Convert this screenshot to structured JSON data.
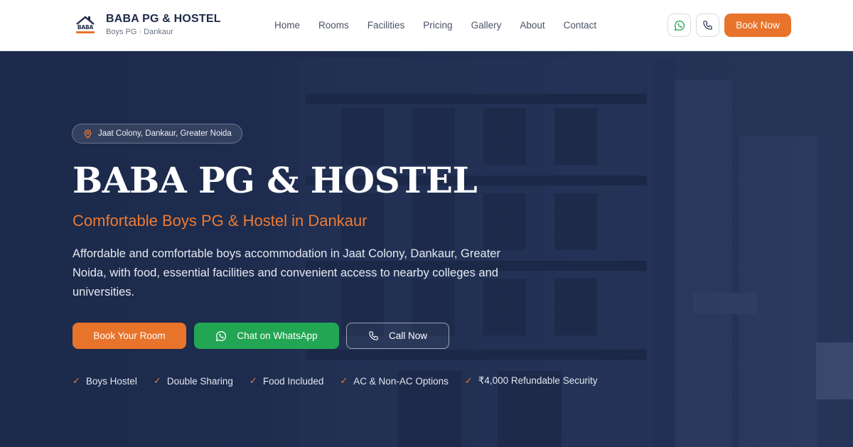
{
  "header": {
    "brand_name": "BABA PG & HOSTEL",
    "brand_sub": "Boys PG · Dankaur",
    "logo_text": "BABA",
    "nav": [
      {
        "label": "Home"
      },
      {
        "label": "Rooms"
      },
      {
        "label": "Facilities"
      },
      {
        "label": "Pricing"
      },
      {
        "label": "Gallery"
      },
      {
        "label": "About"
      },
      {
        "label": "Contact"
      }
    ],
    "whatsapp_icon": "whatsapp-icon",
    "phone_icon": "phone-icon",
    "book_label": "Book Now"
  },
  "hero": {
    "location": "Jaat Colony, Dankaur, Greater Noida",
    "title": "BABA PG & HOSTEL",
    "subtitle": "Comfortable Boys PG & Hostel in Dankaur",
    "description": "Affordable and comfortable boys accommodation in Jaat Colony, Dankaur, Greater Noida, with food, essential facilities and convenient access to nearby colleges and universities.",
    "cta_book": "Book Your Room",
    "cta_whatsapp": "Chat on WhatsApp",
    "cta_call": "Call Now",
    "features": [
      {
        "label": "Boys Hostel"
      },
      {
        "label": "Double Sharing"
      },
      {
        "label": "Food Included"
      },
      {
        "label": "AC & Non-AC Options"
      },
      {
        "label": "₹4,000 Refundable Security"
      }
    ]
  },
  "colors": {
    "accent": "#e8732a",
    "navy": "#1e2a4a",
    "whatsapp": "#22a653"
  }
}
